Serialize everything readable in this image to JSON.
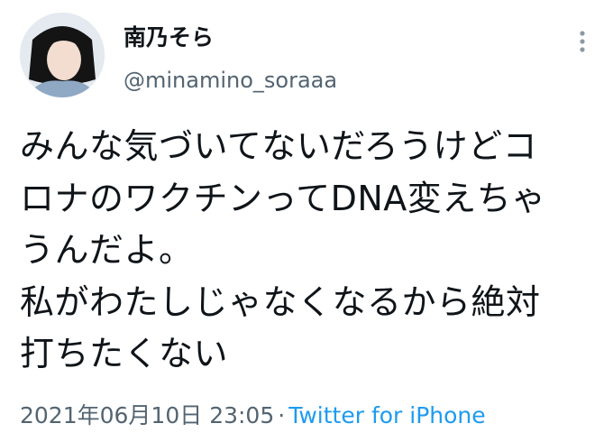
{
  "author": {
    "display_name": "南乃そら",
    "handle": "@minamino_soraaa"
  },
  "tweet": {
    "lines": [
      "みんな気づいてないだろうけどコ",
      "ロナのワクチンってDNA変えちゃ",
      "うんだよ。",
      "私がわたしじゃなくなるから絶対",
      "打ちたくない"
    ],
    "text": "みんな気づいてないだろうけどコ\nロナのワクチンってDNA変えちゃ\nうんだよ。\n私がわたしじゃなくなるから絶対\n打ちたくない"
  },
  "meta": {
    "timestamp": "2021年06月10日 23:05",
    "separator": "·",
    "source": "Twitter for iPhone"
  },
  "icons": {
    "more": "more-vertical-icon"
  },
  "colors": {
    "text": "#0f1419",
    "secondary": "#536471",
    "link": "#1d9bf0"
  }
}
